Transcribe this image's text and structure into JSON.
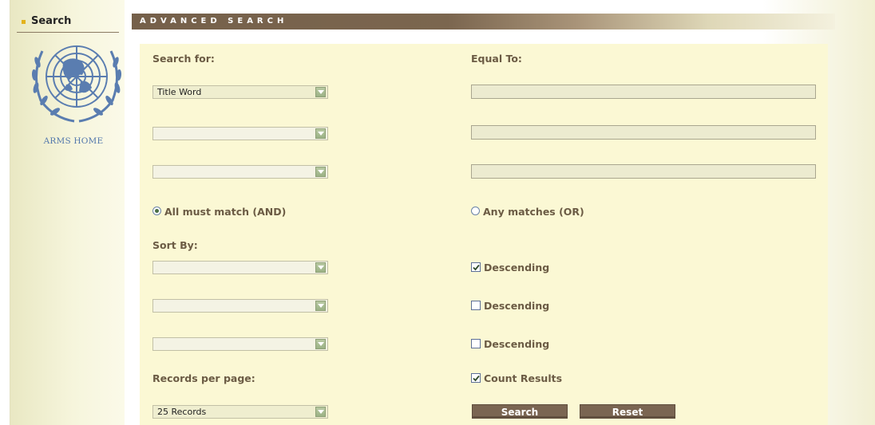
{
  "sidebar": {
    "tab_label": "Search",
    "logo_icon": "un-emblem-icon",
    "home_link": "ARMS HOME"
  },
  "header": {
    "title": "ADVANCED SEARCH"
  },
  "form": {
    "search_for_label": "Search for:",
    "equal_to_label": "Equal To:",
    "search_fields": [
      {
        "selected": "Title Word",
        "value": ""
      },
      {
        "selected": "",
        "value": ""
      },
      {
        "selected": "",
        "value": ""
      }
    ],
    "match_options": {
      "and_label": "All must match (AND)",
      "or_label": "Any matches (OR)",
      "selected": "AND"
    },
    "sort_by_label": "Sort By:",
    "sort_fields": [
      {
        "selected": "",
        "descending_label": "Descending",
        "descending_checked": true
      },
      {
        "selected": "",
        "descending_label": "Descending",
        "descending_checked": false
      },
      {
        "selected": "",
        "descending_label": "Descending",
        "descending_checked": false
      }
    ],
    "records_per_page_label": "Records per page:",
    "records_per_page_selected": "25 Records",
    "count_results_label": "Count Results",
    "count_results_checked": true,
    "search_button": "Search",
    "reset_button": "Reset"
  },
  "colors": {
    "header_bar": "#75604a",
    "panel_bg": "#fbf8d4",
    "label_text": "#6b5b44",
    "button_bg": "#7a6552",
    "link_blue": "#5277ac"
  }
}
